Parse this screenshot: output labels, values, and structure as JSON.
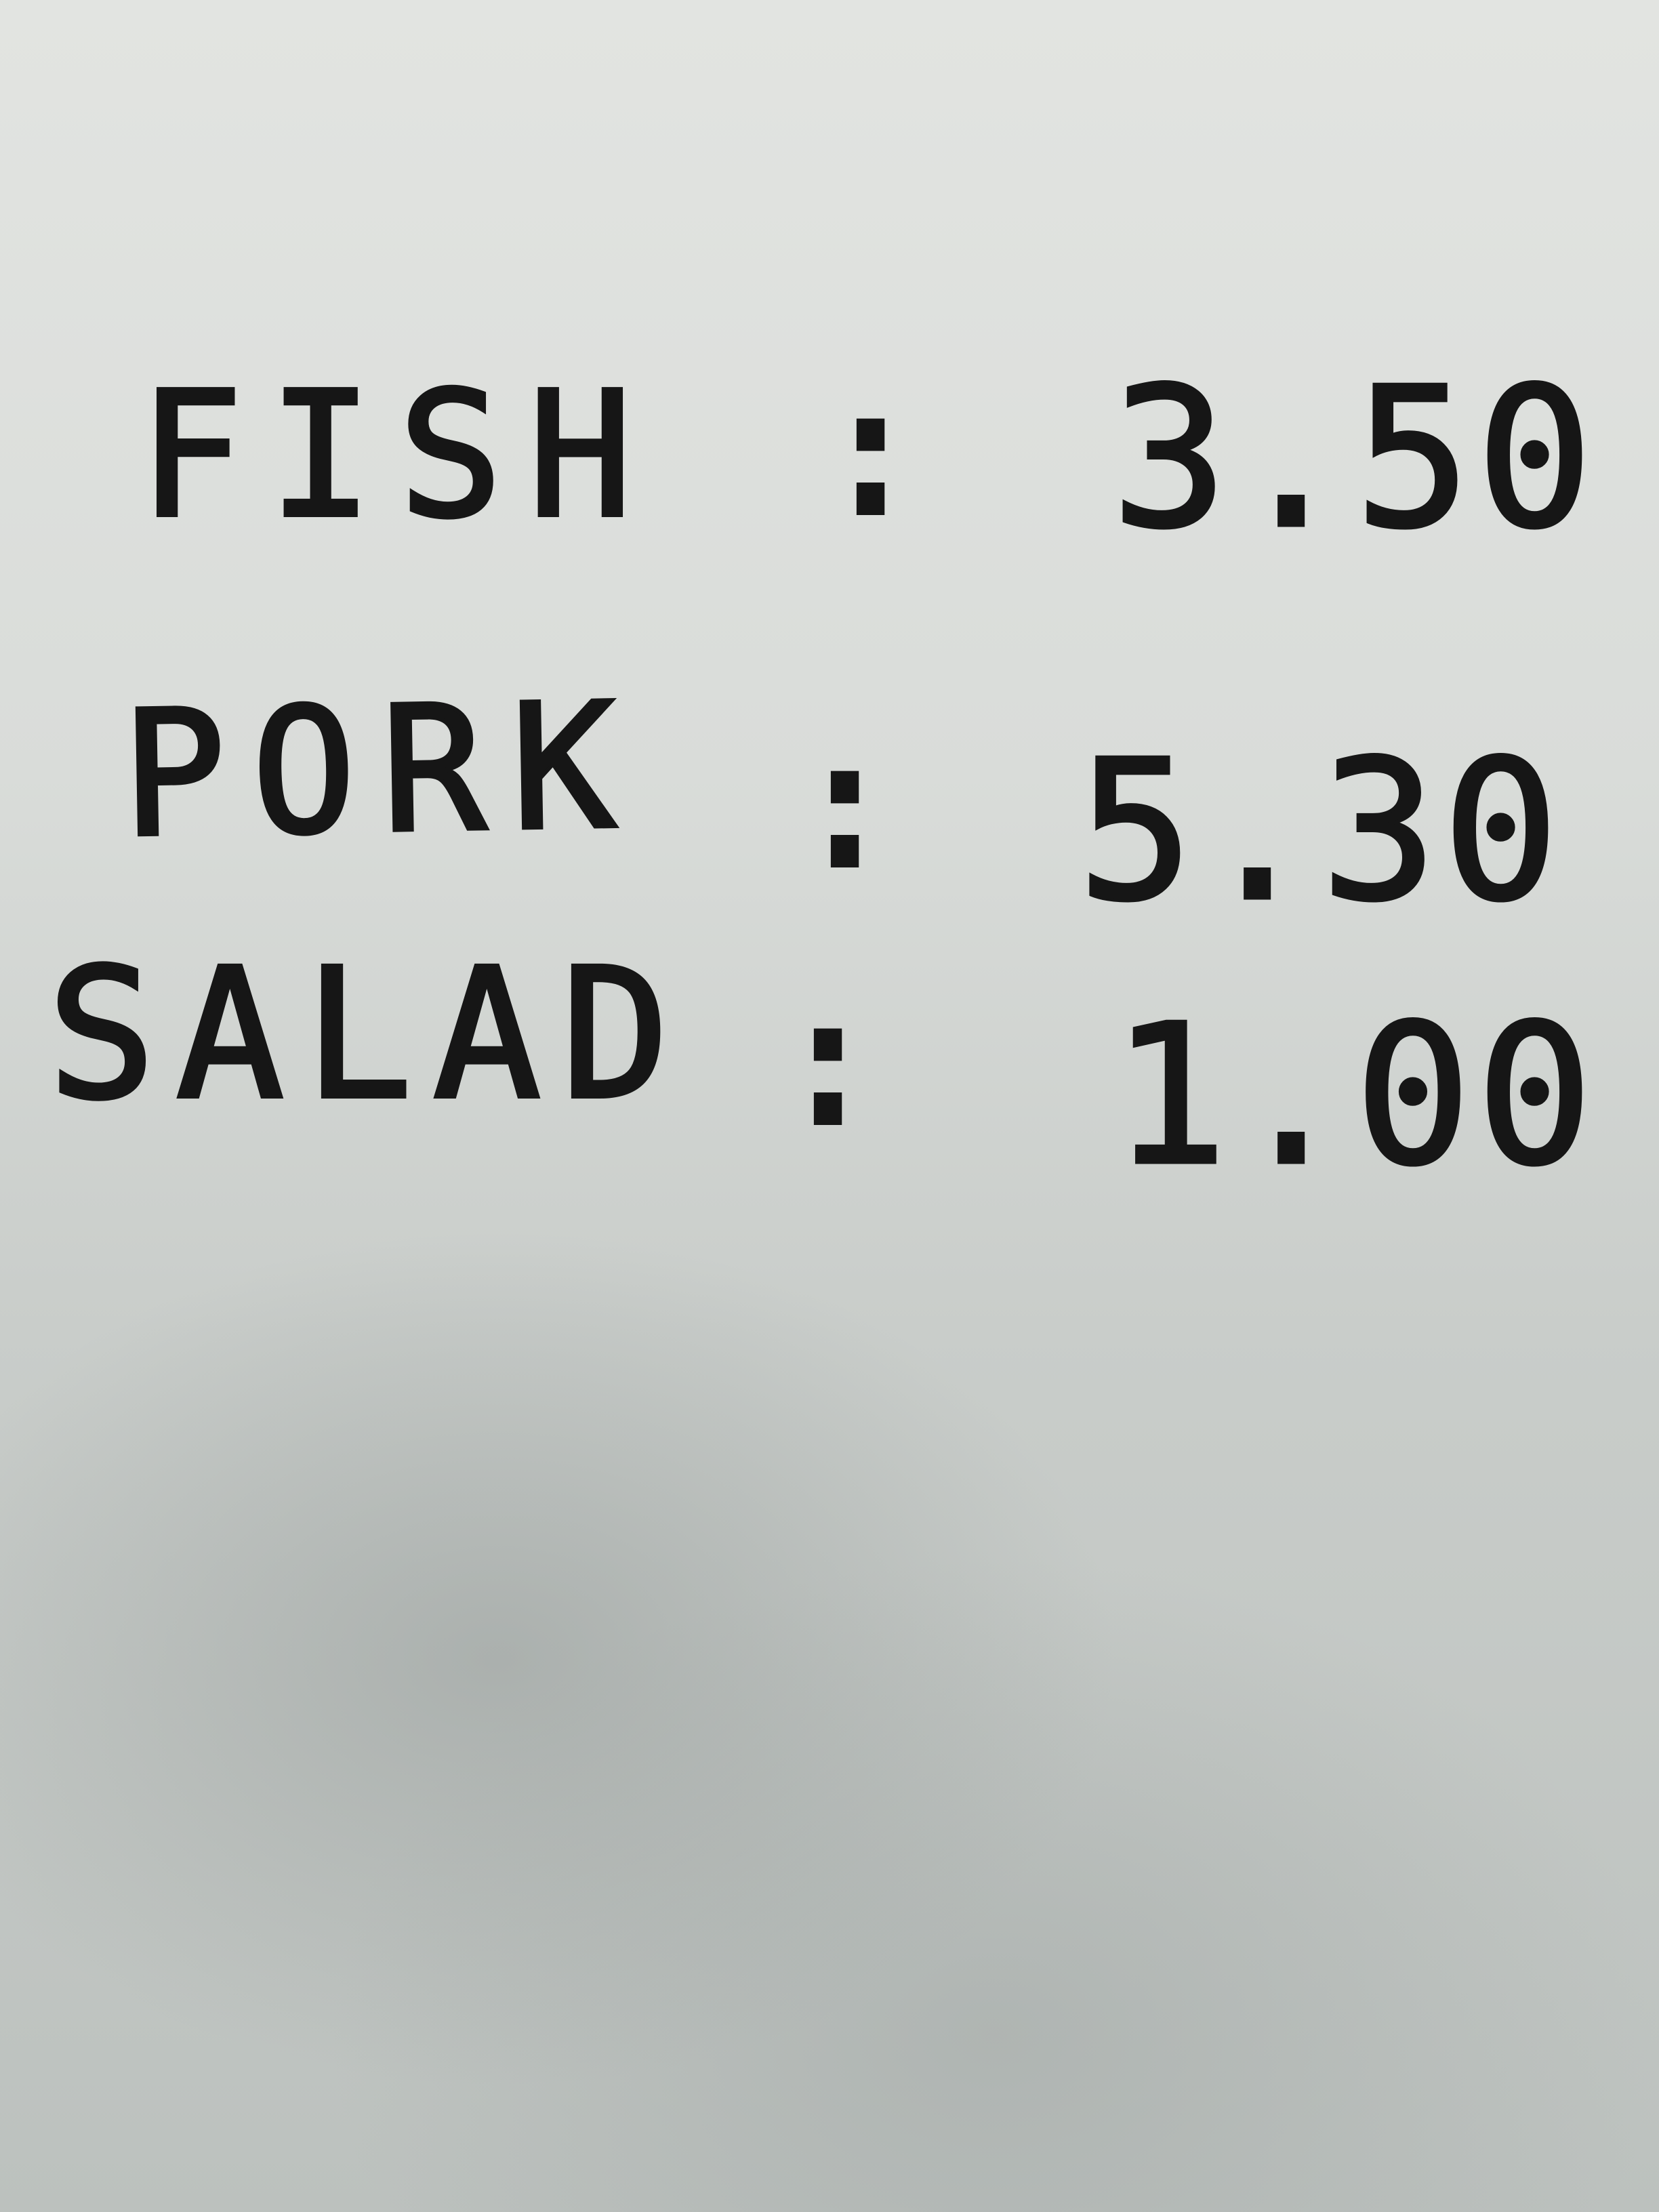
{
  "menu": {
    "rows": [
      {
        "item": "FISH",
        "separator": ":",
        "price": "3.50"
      },
      {
        "item": "PORK",
        "separator": ":",
        "price": "5.30"
      },
      {
        "item": "SALAD",
        "separator": ":",
        "price": "1.00"
      }
    ]
  },
  "colors": {
    "paper": "#d9dcd9",
    "ink": "#161616"
  }
}
